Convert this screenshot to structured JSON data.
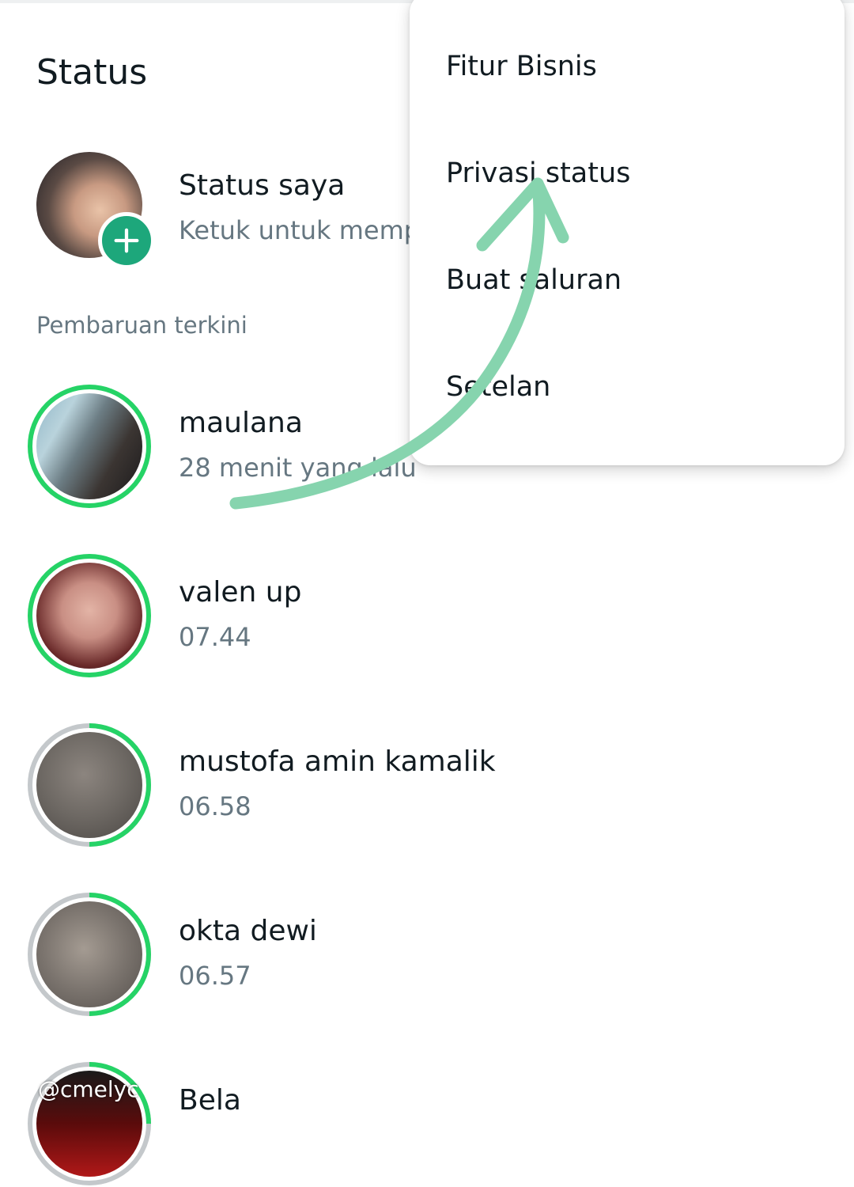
{
  "header": {
    "title": "Status"
  },
  "my_status": {
    "name": "Status saya",
    "subtitle": "Ketuk untuk memp"
  },
  "recent_label": "Pembaruan terkini",
  "contacts": [
    {
      "name": "maulana",
      "time": "28 menit yang lalu"
    },
    {
      "name": "valen up",
      "time": "07.44"
    },
    {
      "name": "mustofa amin kamalik",
      "time": "06.58"
    },
    {
      "name": "okta dewi",
      "time": "06.57"
    },
    {
      "name": "Bela",
      "time": ""
    }
  ],
  "watermark": "@cmelyc",
  "menu": {
    "items": [
      "Fitur Bisnis",
      "Privasi status",
      "Buat saluran",
      "Setelan"
    ]
  },
  "colors": {
    "accent": "#25d366",
    "badge": "#1da77b",
    "seen_ring": "#c4c8cb",
    "annotation_arrow": "#86d4ae"
  }
}
